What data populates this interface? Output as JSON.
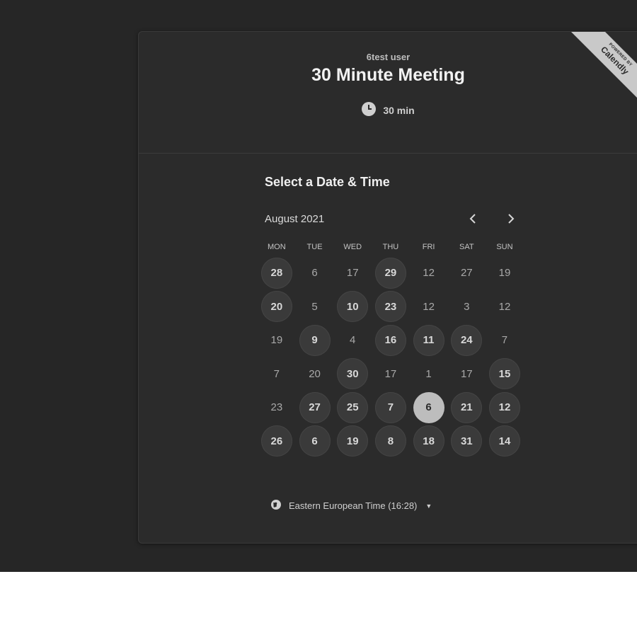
{
  "header": {
    "owner": "6test user",
    "title": "30 Minute Meeting",
    "duration": "30 min"
  },
  "ribbon": {
    "powered_by": "POWERED BY",
    "brand": "Calendly"
  },
  "calendar": {
    "section_title": "Select a Date & Time",
    "month": "August 2021",
    "prev_icon": "chevron-left-icon",
    "next_icon": "chevron-right-icon",
    "weekdays": [
      "MON",
      "TUE",
      "WED",
      "THU",
      "FRI",
      "SAT",
      "SUN"
    ],
    "days": [
      {
        "label": "28",
        "state": "available"
      },
      {
        "label": "6",
        "state": "unavailable"
      },
      {
        "label": "17",
        "state": "unavailable"
      },
      {
        "label": "29",
        "state": "available"
      },
      {
        "label": "12",
        "state": "unavailable"
      },
      {
        "label": "27",
        "state": "unavailable"
      },
      {
        "label": "19",
        "state": "unavailable"
      },
      {
        "label": "20",
        "state": "available"
      },
      {
        "label": "5",
        "state": "unavailable"
      },
      {
        "label": "10",
        "state": "available"
      },
      {
        "label": "23",
        "state": "available"
      },
      {
        "label": "12",
        "state": "unavailable"
      },
      {
        "label": "3",
        "state": "unavailable"
      },
      {
        "label": "12",
        "state": "unavailable"
      },
      {
        "label": "19",
        "state": "unavailable"
      },
      {
        "label": "9",
        "state": "available"
      },
      {
        "label": "4",
        "state": "unavailable"
      },
      {
        "label": "16",
        "state": "available"
      },
      {
        "label": "11",
        "state": "available"
      },
      {
        "label": "24",
        "state": "available"
      },
      {
        "label": "7",
        "state": "unavailable"
      },
      {
        "label": "7",
        "state": "unavailable"
      },
      {
        "label": "20",
        "state": "unavailable"
      },
      {
        "label": "30",
        "state": "available"
      },
      {
        "label": "17",
        "state": "unavailable"
      },
      {
        "label": "1",
        "state": "unavailable"
      },
      {
        "label": "17",
        "state": "unavailable"
      },
      {
        "label": "15",
        "state": "available"
      },
      {
        "label": "23",
        "state": "unavailable"
      },
      {
        "label": "27",
        "state": "available"
      },
      {
        "label": "25",
        "state": "available"
      },
      {
        "label": "7",
        "state": "available"
      },
      {
        "label": "6",
        "state": "selected"
      },
      {
        "label": "21",
        "state": "available"
      },
      {
        "label": "12",
        "state": "available"
      },
      {
        "label": "26",
        "state": "available"
      },
      {
        "label": "6",
        "state": "available"
      },
      {
        "label": "19",
        "state": "available"
      },
      {
        "label": "8",
        "state": "available"
      },
      {
        "label": "18",
        "state": "available"
      },
      {
        "label": "31",
        "state": "available"
      },
      {
        "label": "14",
        "state": "available"
      }
    ],
    "timezone": "Eastern European Time (16:28)",
    "timezone_icon": "globe-icon"
  }
}
